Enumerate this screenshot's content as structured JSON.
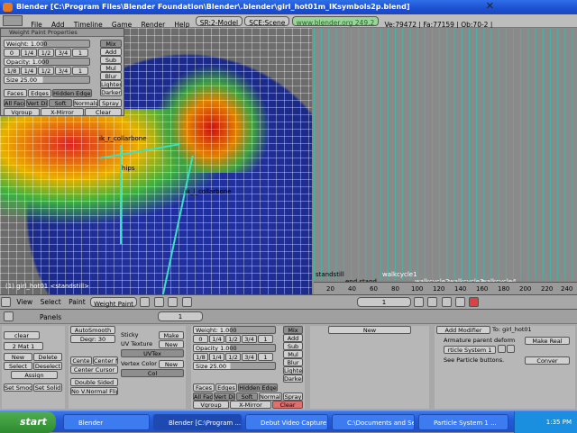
{
  "window": {
    "title": "Blender [C:\\Program Files\\Blender Foundation\\Blender\\.blender\\girl_hot01m_IKsymbols2p.blend]"
  },
  "menubar": {
    "items": [
      "File",
      "Add",
      "Timeline",
      "Game",
      "Render",
      "Help"
    ],
    "screen": "SR:2-Model",
    "scene": "SCE:Scene",
    "url": "www.blender.org 249.2",
    "stats": "Ve:79472 | Fa:77159 | Ob:70-2 |"
  },
  "weight_panel": {
    "title": "Weight Paint Properties",
    "weight": "Weight: 1.000",
    "weight_presets": [
      "0",
      "1/4",
      "1/2",
      "3/4",
      "1"
    ],
    "opacity": "Opacity: 1.000",
    "opacity_presets": [
      "1/8",
      "1/4",
      "1/2",
      "3/4",
      "1"
    ],
    "size": "Size 25.00",
    "modes": [
      "Mix",
      "Add",
      "Sub",
      "Mul",
      "Blur",
      "Lighter",
      "Darker"
    ],
    "toggles": [
      "Faces",
      "Edges",
      "Hidden Edges"
    ],
    "options": [
      "All Faces",
      "Vert Dist",
      "Soft",
      "Normals",
      "Spray"
    ],
    "bottom": [
      "Vgroup",
      "X-Mirror",
      "Clear"
    ]
  },
  "viewport": {
    "labels": [
      "ik_r_collarbone",
      "hips",
      "ik_l_collarbone",
      "(1) girl_hot01 <standstill>"
    ]
  },
  "timeline": {
    "markers": [
      "standstill",
      "end stand",
      "walkcycle1",
      "walkcycle2",
      "walkcycle3",
      "walkcycle4"
    ],
    "ticks": [
      "20",
      "40",
      "60",
      "80",
      "100",
      "120",
      "140",
      "160",
      "180",
      "200",
      "220",
      "240"
    ],
    "frame": "1"
  },
  "view_header": {
    "items": [
      "View",
      "Select",
      "Paint"
    ],
    "mode": "Weight Paint"
  },
  "buttons": {
    "panels_label": "Panels",
    "frame": "1",
    "mat": "2 Mat 1",
    "clear": "clear",
    "mat_buttons": [
      "New",
      "Delete",
      "Select",
      "Deselect",
      "Assign"
    ],
    "smooth": [
      "Set Smoo",
      "Set Solid"
    ],
    "degr": "Degr: 30",
    "auto_smooth": "AutoSmooth",
    "center": [
      "Cente",
      "Center Ne",
      "Center Cursor"
    ],
    "double_sided": "Double Sided",
    "no_vnormal": "No V.Normal Flip",
    "sticky": "Sticky",
    "uv_texture": "UV Texture",
    "uvtex": "UVTex",
    "vertex_color": "Vertex Color",
    "col": "Col",
    "make": "Make",
    "new": "New",
    "weight2": "Weight: 1.000",
    "opacity2": "Opacity 1.000",
    "size2": "Size 25.00",
    "presets2": [
      "0",
      "1/4",
      "1/2",
      "3/4",
      "1"
    ],
    "presets2b": [
      "1/8",
      "1/4",
      "1/2",
      "3/4",
      "1"
    ],
    "modes2": [
      "Mix",
      "Add",
      "Sub",
      "Mul",
      "Blur",
      "Lighter",
      "Darker"
    ],
    "faces_row": [
      "Faces",
      "Edges",
      "Hidden Edge"
    ],
    "options2": [
      "All Faces",
      "Vert Dis",
      "Soft",
      "Normals",
      "Spray"
    ],
    "bottom2": [
      "Vgroup",
      "X-Mirror",
      "Clear"
    ],
    "add_modifier": "Add Modifier",
    "to": "To: girl_hot01",
    "armature": "Armature parent deform",
    "make_real": "Make Real",
    "particle_system": "rticle System 1",
    "see_particle": "See Particle buttons.",
    "convert": "Conver"
  },
  "taskbar": {
    "start": "start",
    "tasks": [
      "Blender",
      "Blender [C:\\Program ...",
      "Debut Video Capture ...",
      "C:\\Documents and Se...",
      "Particle System 1 ..."
    ],
    "clock": "1:35 PM"
  }
}
